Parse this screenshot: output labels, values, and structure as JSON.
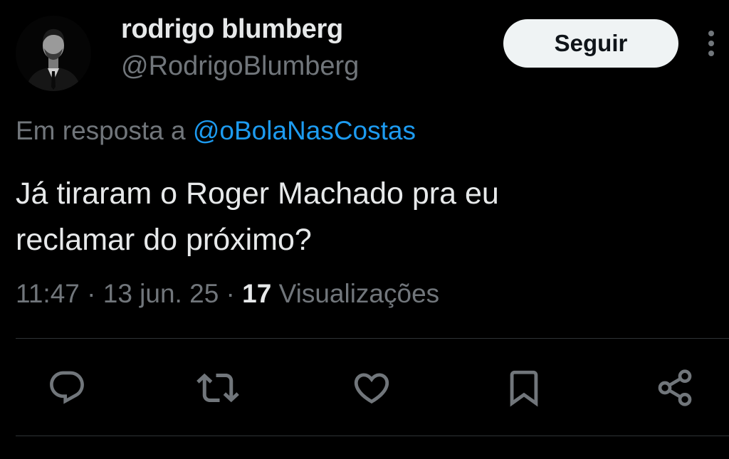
{
  "author": {
    "display_name": "rodrigo blumberg",
    "handle": "@RodrigoBlumberg",
    "avatar": "profile-photo"
  },
  "follow_button": {
    "label": "Seguir"
  },
  "more_icon": "more-vertical-icon",
  "reply_context": {
    "prefix": "Em resposta a ",
    "mention": "@oBolaNasCostas"
  },
  "tweet": {
    "text_lines": [
      "Já tiraram o Roger Machado pra eu",
      "reclamar do próximo?"
    ],
    "time": "11:47",
    "separator": " · ",
    "date": "13 jun. 25",
    "views_count": "17",
    "views_label": " Visualizações"
  },
  "actions": [
    {
      "icon": "reply-icon"
    },
    {
      "icon": "retweet-icon"
    },
    {
      "icon": "like-icon"
    },
    {
      "icon": "bookmark-icon"
    },
    {
      "icon": "share-icon"
    }
  ],
  "colors": {
    "background": "#000000",
    "primary_text": "#e7e9ea",
    "secondary_text": "#71767b",
    "link": "#1d9bf0",
    "divider": "#2f3336",
    "button_bg": "#eff3f4",
    "button_text": "#0f1419"
  }
}
